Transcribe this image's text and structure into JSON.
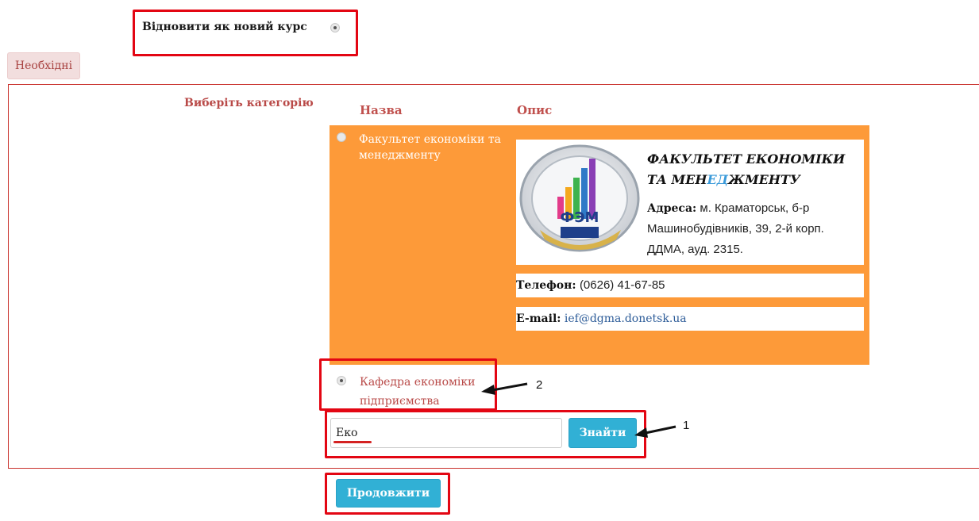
{
  "restore": {
    "label": "Відновити як новий курс",
    "checked": true
  },
  "required_button": "Необхідні",
  "category": {
    "choose_label": "Виберіть категорію",
    "col_name": "Назва",
    "col_desc": "Опис",
    "faculty": {
      "name": "Факультет економіки та менеджменту",
      "title_part1": "ФАКУЛЬТЕТ ЕКОНОМІКИ",
      "title_part2a": "ТА МЕН",
      "title_part2b": "ЕД",
      "title_part2c": "ЖМЕНТУ",
      "logo_text": "ФЭМ",
      "address_label": "Адреса:",
      "address_value": "м. Краматорськ, б-р Машинобудівників, 39, 2-й корп. ДДМА, ауд. 2315.",
      "phone_label": "Телефон:",
      "phone_value": "(0626) 41-67-85",
      "email_label": "E-mail:",
      "email_value": "ief@dgma.donetsk.ua",
      "checked": false
    },
    "department": {
      "name": "Кафедра економіки підприємства",
      "checked": true
    }
  },
  "search": {
    "value": "Еко",
    "button": "Знайти"
  },
  "continue_button": "Продовжити",
  "annotations": {
    "arrow_1": "1",
    "arrow_2": "2"
  },
  "colors": {
    "annotation_red": "#e30613",
    "orange": "#fd9a39",
    "button_blue": "#31b0d5"
  }
}
